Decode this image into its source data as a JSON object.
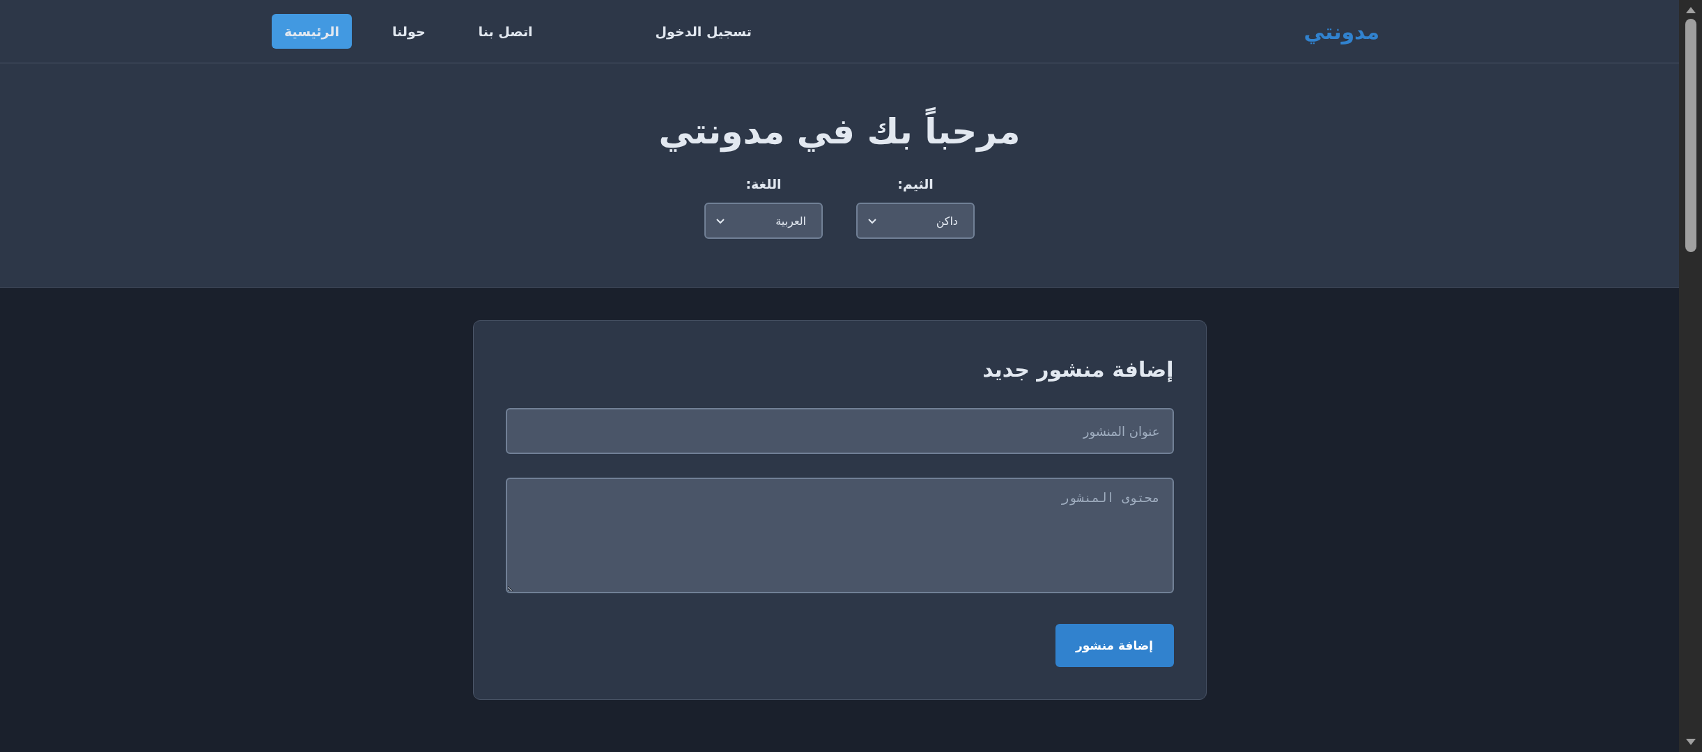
{
  "nav": {
    "logo": "مدونتي",
    "links": [
      {
        "label": "تسجيل الدخول",
        "selected": false
      },
      {
        "label": "اتصل بنا",
        "selected": false
      },
      {
        "label": "حولنا",
        "selected": false
      },
      {
        "label": "الرئيسية",
        "selected": true
      }
    ]
  },
  "hero": {
    "title": "مرحباً بك في مدونتي",
    "settings": [
      {
        "label": "الثيم:",
        "value": "داكن"
      },
      {
        "label": "اللغة:",
        "value": "العربية"
      }
    ]
  },
  "form": {
    "title": "إضافة منشور جديد",
    "fields": [
      {
        "kind": "input",
        "placeholder": "عنوان المنشور"
      },
      {
        "kind": "textarea",
        "placeholder": "محتوى المنشور"
      }
    ],
    "submit": "إضافة منشور"
  }
}
